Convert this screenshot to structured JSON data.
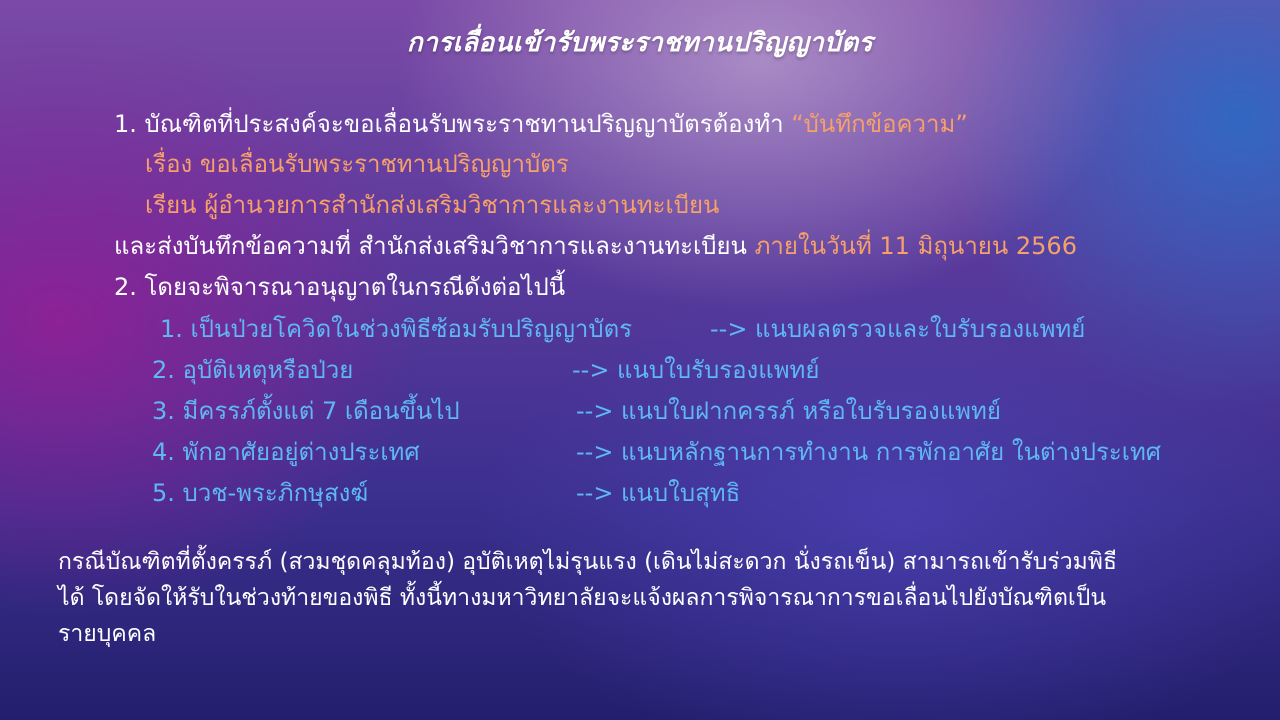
{
  "title": "การเลื่อนเข้ารับพระราชทานปริญญาบัตร",
  "point1": {
    "text": "1. บัณฑิตที่ประสงค์จะขอเลื่อนรับพระราชทานปริญญาบัตรต้องทำ ",
    "highlight": "“บันทึกข้อความ”",
    "subject": "เรื่อง ขอเลื่อนรับพระราชทานปริญญาบัตร",
    "recipient": "เรียน ผู้อำนวยการสำนักส่งเสริมวิชาการและงานทะเบียน",
    "submit_text": "และส่งบันทึกข้อความที่ สำนักส่งเสริมวิชาการและงานทะเบียน ",
    "deadline": "ภายในวันที่ 11 มิถุนายน 2566"
  },
  "point2": {
    "text": "2. โดยจะพิจารณาอนุญาตในกรณีดังต่อไปนี้",
    "cases": [
      {
        "label": "1. เป็นป่วยโควิดในช่วงพิธีซ้อมรับปริญญาบัตร",
        "attach": "--> แนบผลตรวจและใบรับรองแพทย์"
      },
      {
        "label": "2. อุบัติเหตุหรือป่วย",
        "attach": "--> แนบใบรับรองแพทย์"
      },
      {
        "label": "3. มีครรภ์ตั้งแต่ 7 เดือนขึ้นไป",
        "attach": "--> แนบใบฝากครรภ์ หรือใบรับรองแพทย์"
      },
      {
        "label": "4. พักอาศัยอยู่ต่างประเทศ",
        "attach": "--> แนบหลักฐานการทำงาน การพักอาศัย ในต่างประเทศ"
      },
      {
        "label": "5. บวช-พระภิกษุสงฆ์",
        "attach": "--> แนบใบสุทธิ"
      }
    ]
  },
  "note": {
    "line1": "กรณีบัณฑิตที่ตั้งครรภ์ (สวมชุดคลุมท้อง) อุบัติเหตุไม่รุนแรง (เดินไม่สะดวก นั่งรถเข็น) สามารถเข้ารับร่วมพิธี",
    "line2": "ได้ โดยจัดให้รับในช่วงท้ายของพิธี ทั้งนี้ทางมหาวิทยาลัยจะแจ้งผลการพิจารณาการขอเลื่อนไปยังบัณฑิตเป็น",
    "line3": "รายบุคคล"
  },
  "colors": {
    "title": "#ffffff",
    "highlight": "#f6a06a",
    "cases": "#5fb8f2"
  }
}
